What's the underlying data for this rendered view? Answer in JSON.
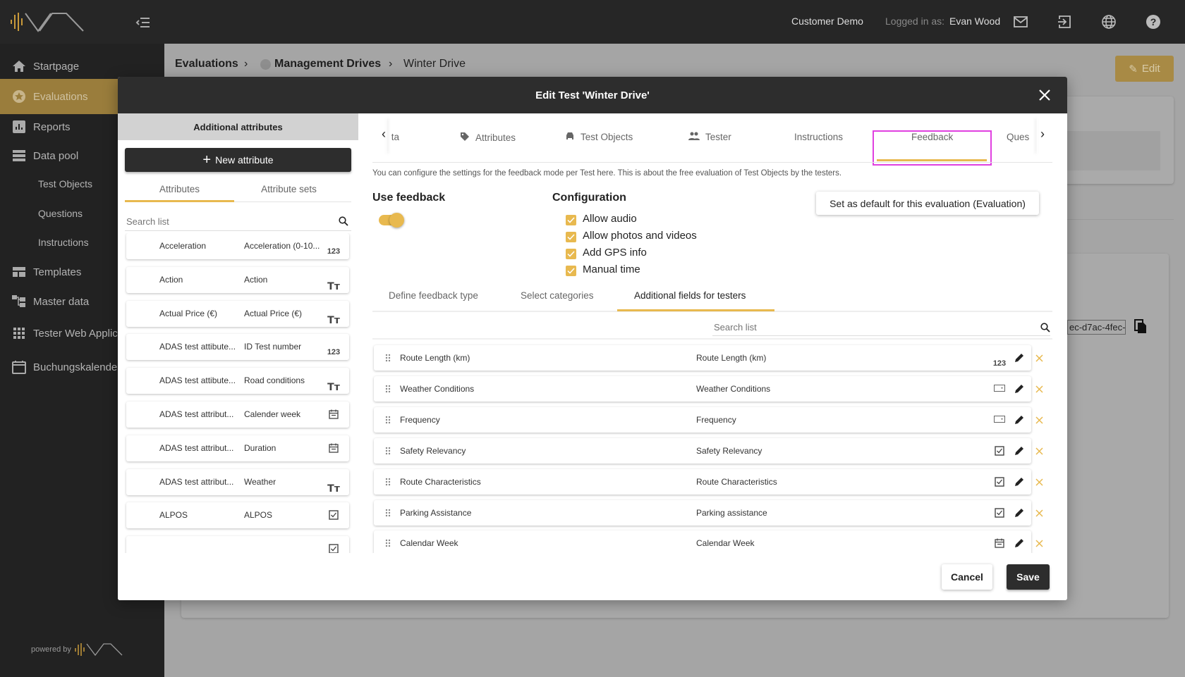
{
  "topbar": {
    "customer": "Customer Demo",
    "logged_in_label": "Logged in as:",
    "user": "Evan Wood"
  },
  "sidebar": {
    "items": [
      {
        "label": "Startpage",
        "icon": "home-icon"
      },
      {
        "label": "Evaluations",
        "icon": "star-icon",
        "active": true
      },
      {
        "label": "Reports",
        "icon": "bar-chart-icon"
      },
      {
        "label": "Data pool",
        "icon": "storage-icon"
      },
      {
        "label": "Test Objects",
        "sub": true
      },
      {
        "label": "Questions",
        "sub": true
      },
      {
        "label": "Instructions",
        "sub": true
      },
      {
        "label": "Templates",
        "icon": "templates-icon"
      },
      {
        "label": "Master data",
        "icon": "hierarchy-icon"
      },
      {
        "label": "Tester Web Applic",
        "icon": "apps-grid-icon"
      },
      {
        "label": "Buchungskalender",
        "icon": "calendar-icon"
      }
    ],
    "powered_by": "powered by"
  },
  "breadcrumb": [
    "Evaluations",
    "Management Drives",
    "Winter Drive"
  ],
  "background": {
    "edit_label": "Edit",
    "id_fragment": "ec-d7ac-4fec-"
  },
  "modal": {
    "title": "Edit Test 'Winter Drive'",
    "left": {
      "header": "Additional attributes",
      "new_button": "New attribute",
      "tabs": [
        "Attributes",
        "Attribute sets"
      ],
      "search_placeholder": "Search list",
      "items": [
        {
          "name": "Acceleration",
          "label": "Acceleration (0-10...",
          "type": "number"
        },
        {
          "name": "Action",
          "label": "Action",
          "type": "text"
        },
        {
          "name": "Actual Price (€)",
          "label": "Actual Price (€)",
          "type": "text"
        },
        {
          "name": "ADAS test attibute...",
          "label": "ID Test number",
          "type": "number"
        },
        {
          "name": "ADAS test attibute...",
          "label": "Road conditions",
          "type": "text"
        },
        {
          "name": "ADAS test attribut...",
          "label": "Calender week",
          "type": "calendar"
        },
        {
          "name": "ADAS test attribut...",
          "label": "Duration",
          "type": "calendar"
        },
        {
          "name": "ADAS test attribut...",
          "label": "Weather",
          "type": "text"
        },
        {
          "name": "ALPOS",
          "label": "ALPOS",
          "type": "checkbox"
        },
        {
          "name": "",
          "label": "",
          "type": "checkbox"
        }
      ]
    },
    "tabs": [
      "ta",
      "Attributes",
      "Test Objects",
      "Tester",
      "Instructions",
      "Feedback",
      "Ques"
    ],
    "active_tab": "Feedback",
    "description": "You can configure the settings for the feedback mode per Test here. This is about the free evaluation of Test Objects by the testers.",
    "use_feedback": {
      "label": "Use feedback",
      "enabled": true
    },
    "configuration": {
      "title": "Configuration",
      "options": [
        {
          "label": "Allow audio",
          "checked": true
        },
        {
          "label": "Allow photos and videos",
          "checked": true
        },
        {
          "label": "Add GPS info",
          "checked": true
        },
        {
          "label": "Manual time",
          "checked": true
        }
      ]
    },
    "default_button": "Set as default for this evaluation (Evaluation)",
    "subtabs": [
      "Define feedback type",
      "Select categories",
      "Additional fields for testers"
    ],
    "active_subtab": "Additional fields for testers",
    "search_placeholder": "Search list",
    "fields": [
      {
        "name": "Route Length (km)",
        "label": "Route Length (km)",
        "type": "number"
      },
      {
        "name": "Weather Conditions",
        "label": "Weather Conditions",
        "type": "dropdown"
      },
      {
        "name": "Frequency",
        "label": "Frequency",
        "type": "dropdown"
      },
      {
        "name": "Safety Relevancy",
        "label": "Safety Relevancy",
        "type": "checkbox"
      },
      {
        "name": "Route Characteristics",
        "label": "Route Characteristics",
        "type": "checkbox"
      },
      {
        "name": "Parking Assistance",
        "label": "Parking assistance",
        "type": "checkbox"
      },
      {
        "name": "Calendar Week",
        "label": "Calendar Week",
        "type": "calendar"
      }
    ],
    "number_glyph": "123",
    "text_glyph": "Tт",
    "cancel": "Cancel",
    "save": "Save"
  },
  "colors": {
    "accent": "#e8b94f",
    "highlight": "#e040e0",
    "dark": "#2d2d2d"
  }
}
